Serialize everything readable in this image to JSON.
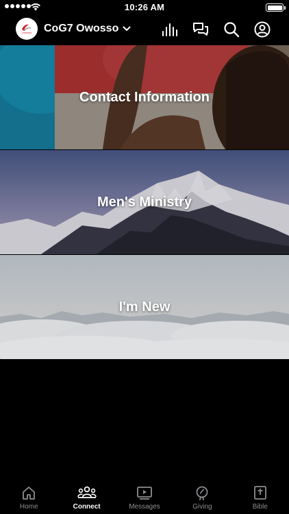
{
  "status_bar": {
    "time": "10:26 AM"
  },
  "header": {
    "church_name": "CoG7 Owosso",
    "logo_text": "Owosso",
    "icons": [
      "live-icon",
      "chat-icon",
      "search-icon",
      "profile-icon"
    ]
  },
  "cards": [
    {
      "title": "Contact Information"
    },
    {
      "title": "Men's Ministry"
    },
    {
      "title": "I'm New"
    }
  ],
  "tabbar": {
    "active": "Connect",
    "tabs": [
      {
        "label": "Home",
        "icon": "home-icon"
      },
      {
        "label": "Connect",
        "icon": "people-icon"
      },
      {
        "label": "Messages",
        "icon": "play-icon"
      },
      {
        "label": "Giving",
        "icon": "giving-icon"
      },
      {
        "label": "Bible",
        "icon": "bible-icon"
      }
    ]
  },
  "colors": {
    "background": "#000000",
    "tab_inactive": "#8e8e93",
    "tab_active": "#ffffff",
    "logo_accent": "#d0202e"
  }
}
